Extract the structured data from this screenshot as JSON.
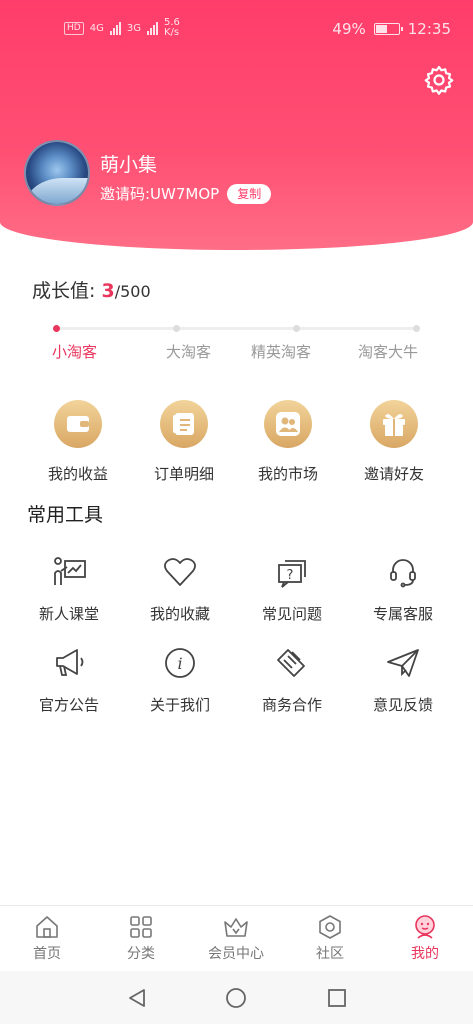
{
  "status": {
    "network_left": [
      "HD",
      "4G",
      "3G"
    ],
    "speed": "5.6\nK/s",
    "battery": "49%",
    "battery_level": 0.49,
    "time": "12:35"
  },
  "profile": {
    "name": "萌小集",
    "invite_label": "邀请码:UW7MOP",
    "copy_label": "复制"
  },
  "growth": {
    "label": "成长值:",
    "current": "3",
    "max": "/500",
    "levels": [
      "小淘客",
      "大淘客",
      "精英淘客",
      "淘客大牛"
    ],
    "active_level": 0
  },
  "quick": [
    {
      "label": "我的收益",
      "icon": "wallet-icon"
    },
    {
      "label": "订单明细",
      "icon": "order-list-icon"
    },
    {
      "label": "我的市场",
      "icon": "users-icon"
    },
    {
      "label": "邀请好友",
      "icon": "gift-icon"
    }
  ],
  "tools_title": "常用工具",
  "tools": [
    {
      "label": "新人课堂",
      "icon": "classroom-icon"
    },
    {
      "label": "我的收藏",
      "icon": "heart-icon"
    },
    {
      "label": "常见问题",
      "icon": "question-icon"
    },
    {
      "label": "专属客服",
      "icon": "headset-icon"
    },
    {
      "label": "官方公告",
      "icon": "megaphone-icon"
    },
    {
      "label": "关于我们",
      "icon": "info-icon"
    },
    {
      "label": "商务合作",
      "icon": "handshake-icon"
    },
    {
      "label": "意见反馈",
      "icon": "paper-plane-icon"
    }
  ],
  "tabs": [
    {
      "label": "首页",
      "icon": "home-icon"
    },
    {
      "label": "分类",
      "icon": "grid-icon"
    },
    {
      "label": "会员中心",
      "icon": "crown-icon"
    },
    {
      "label": "社区",
      "icon": "hexagon-icon"
    },
    {
      "label": "我的",
      "icon": "profile-icon"
    }
  ],
  "active_tab": 4,
  "colors": {
    "accent": "#e8365d",
    "header": "#ff4f73",
    "gold": "#d9a764"
  }
}
